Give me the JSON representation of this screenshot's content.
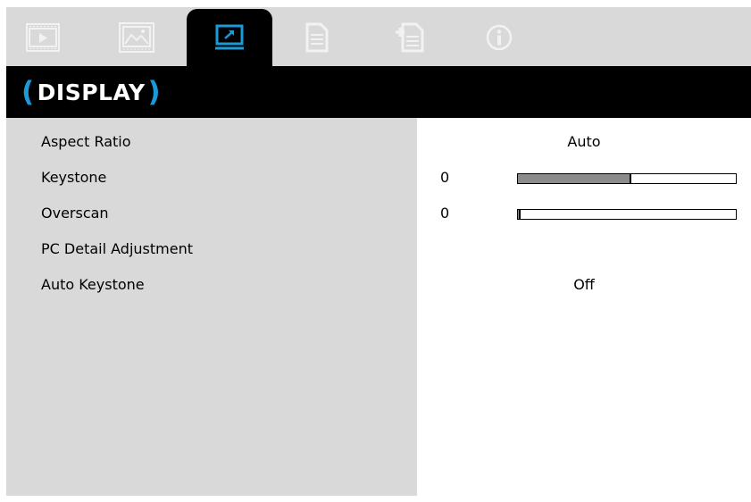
{
  "tabs": [
    {
      "name": "image-tab",
      "icon": "film-icon",
      "active": false
    },
    {
      "name": "picture-tab",
      "icon": "picture-icon",
      "active": false
    },
    {
      "name": "display-tab",
      "icon": "display-icon",
      "active": true
    },
    {
      "name": "setup-tab",
      "icon": "document-icon",
      "active": false
    },
    {
      "name": "options-tab",
      "icon": "document-plus-icon",
      "active": false
    },
    {
      "name": "info-tab",
      "icon": "info-icon",
      "active": false
    }
  ],
  "header": {
    "title": "DISPLAY",
    "open_paren": "(",
    "close_paren": ")"
  },
  "menu": {
    "items": [
      {
        "label": "Aspect Ratio",
        "value": "Auto"
      },
      {
        "label": "Keystone",
        "value": "0",
        "level": 0.52
      },
      {
        "label": "Overscan",
        "value": "0",
        "level": 0.0
      },
      {
        "label": "PC Detail Adjustment"
      },
      {
        "label": "Auto Keystone",
        "value": "Off"
      }
    ]
  },
  "colors": {
    "accent": "#1a9ad6",
    "panel": "#d9d9d9",
    "title_bg": "#000000",
    "bar_fill": "#8c8c8c"
  }
}
